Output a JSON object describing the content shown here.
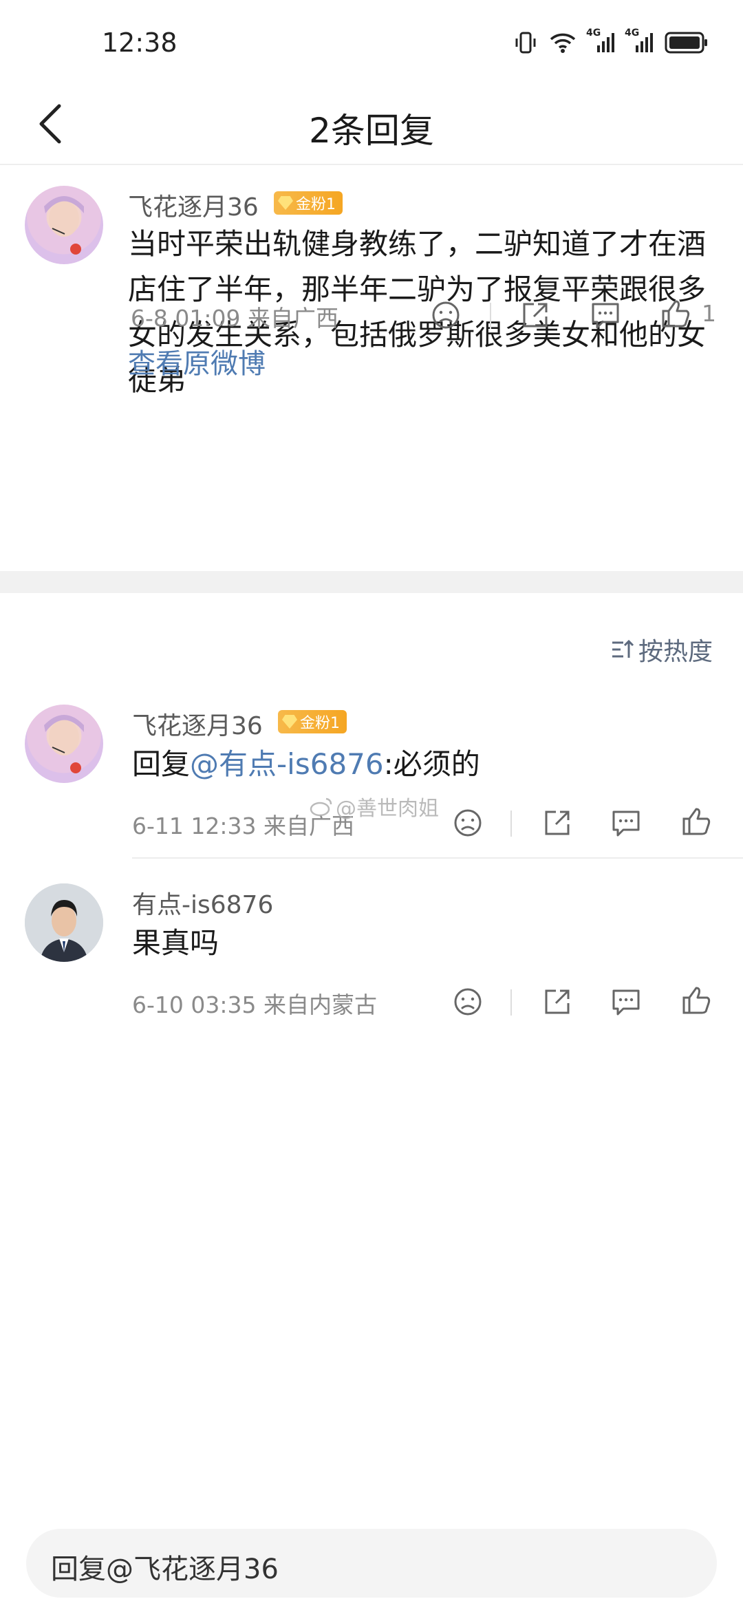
{
  "status_bar": {
    "time": "12:38",
    "network_1": "4G",
    "network_2": "4G"
  },
  "nav": {
    "title": "2条回复"
  },
  "root_comment": {
    "username": "飞花逐月36",
    "badge": "金粉1",
    "text": "当时平荣出轨健身教练了，二驴知道了才在酒店住了半年，那半年二驴为了报复平荣跟很多女的发生关系，包括俄罗斯很多美女和他的女徒弟",
    "meta": "6-8 01:09  来自广西",
    "like_count": "1",
    "view_original": "查看原微博"
  },
  "sort": {
    "label": "按热度"
  },
  "replies": [
    {
      "username": "飞花逐月36",
      "badge": "金粉1",
      "text_prefix": "回复",
      "mention": "@有点-is6876",
      "text_suffix": ":必须的",
      "meta": "6-11 12:33  来自广西"
    },
    {
      "username": "有点-is6876",
      "text": "果真吗",
      "meta": "6-10 03:35  来自内蒙古"
    }
  ],
  "watermark": "@善世肉姐",
  "reply_bar": {
    "placeholder": "回复@飞花逐月36"
  },
  "icons": [
    "back-icon",
    "vibrate-icon",
    "wifi-icon",
    "signal-icon",
    "battery-icon",
    "dislike-face-icon",
    "share-icon",
    "comment-icon",
    "thumbs-up-icon",
    "sort-icon"
  ],
  "colors": {
    "link": "#4f7bb2",
    "badge": "#f5a623",
    "meta": "#8a8a8a"
  }
}
